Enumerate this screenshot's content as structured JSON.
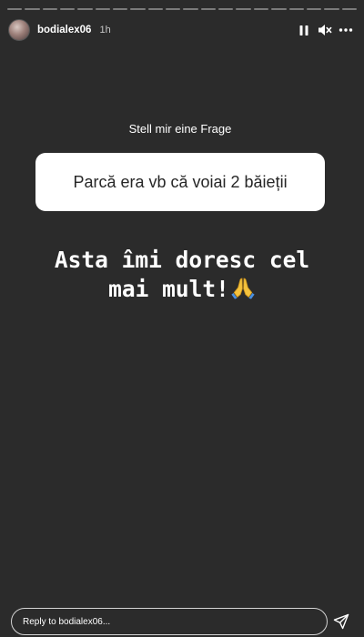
{
  "story": {
    "background_color": "#2b2b2b",
    "progress_segments": 20,
    "progress_current_segment": 1
  },
  "header": {
    "username": "bodialex06",
    "time": "1h",
    "icons": [
      "pause-icon",
      "mute-icon",
      "more-icon"
    ]
  },
  "question": {
    "title": "Stell mir eine Frage",
    "text": "Parcă era vb că voiai 2 băieții"
  },
  "answer": {
    "line1": "Asta îmi doresc cel",
    "line2": "mai mult!",
    "emoji": "folded-hands-emoji"
  },
  "reply": {
    "placeholder": "Reply to bodialex06..."
  }
}
